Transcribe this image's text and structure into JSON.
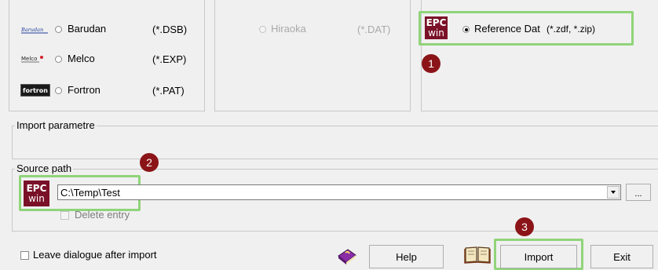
{
  "formats": {
    "barudan": {
      "logo": "Barudan",
      "label": "Barudan",
      "ext": "(*.DSB)"
    },
    "melco": {
      "logo": "Melco",
      "label": "Melco",
      "ext": "(*.EXP)"
    },
    "fortron": {
      "logo": "fortron",
      "label": "Fortron",
      "ext": "(*.PAT)"
    },
    "hiraoka": {
      "label": "Hiraoka",
      "ext": "(*.DAT)"
    },
    "reference": {
      "label": "Reference Dat",
      "ext": "(*.zdf, *.zip)"
    }
  },
  "epc": {
    "line1": "EPC",
    "line2": "win"
  },
  "import_params": {
    "legend": "Import parametre"
  },
  "source": {
    "legend": "Source path",
    "path": "C:\\Temp\\Test",
    "browse": "...",
    "delete_entry": "Delete entry"
  },
  "footer": {
    "leave_dialogue": "Leave dialogue after import",
    "help": "Help",
    "import": "Import",
    "exit": "Exit"
  },
  "badges": [
    "1",
    "2",
    "3"
  ],
  "colors": {
    "epc_bg": "#7a1128",
    "highlight": "#90d47a",
    "badge": "#8b1418"
  }
}
